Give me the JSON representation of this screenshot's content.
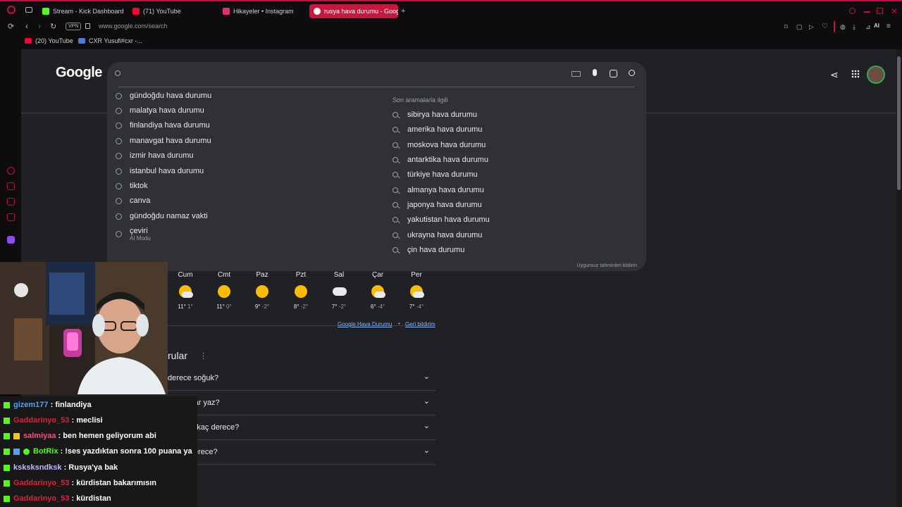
{
  "tabs": [
    {
      "label": "Stream - Kick Dashboard",
      "color": "#53fc18"
    },
    {
      "label": "(71) YouTube",
      "color": "#ff0033"
    },
    {
      "label": "Hikayeler • Instagram",
      "color": "#e1306c"
    },
    {
      "label": "rusya hava durumu - Goog",
      "color": "#ffffff",
      "active": true
    }
  ],
  "address": {
    "url": "www.google.com/search",
    "vpn": "VPN"
  },
  "bookmarks": [
    {
      "label": "(20) YouTube"
    },
    {
      "label": "CXR Yusufi#cxr -..."
    }
  ],
  "google": {
    "logo": "Google",
    "search_value": "",
    "related_header": "Son aramalarla ilgili",
    "recent": [
      {
        "label": "gündoğdu hava durumu"
      },
      {
        "label": "malatya hava durumu"
      },
      {
        "label": "finlandiya hava durumu"
      },
      {
        "label": "manavgat hava durumu"
      },
      {
        "label": "izmir hava durumu"
      },
      {
        "label": "istanbul hava durumu"
      },
      {
        "label": "tiktok"
      },
      {
        "label": "canva"
      },
      {
        "label": "gündoğdu namaz vakti"
      },
      {
        "label": "çeviri",
        "sub": "AI Modu"
      }
    ],
    "related": [
      "sibirya hava durumu",
      "amerika hava durumu",
      "moskova hava durumu",
      "antarktika hava durumu",
      "türkiye hava durumu",
      "almanya hava durumu",
      "japonya hava durumu",
      "yakutistan hava durumu",
      "ukrayna hava durumu",
      "çin hava durumu"
    ],
    "report": "Uygunsuz tahminleri bildirin"
  },
  "weather": {
    "days": [
      {
        "day": "Cum",
        "hi": "11°",
        "lo": "1°",
        "icon": "partly-cloudy"
      },
      {
        "day": "Cmt",
        "hi": "11°",
        "lo": "0°",
        "icon": "sunny"
      },
      {
        "day": "Paz",
        "hi": "9°",
        "lo": "-2°",
        "icon": "sunny"
      },
      {
        "day": "Pzt",
        "hi": "8°",
        "lo": "-2°",
        "icon": "sunny"
      },
      {
        "day": "Sal",
        "hi": "7°",
        "lo": "-2°",
        "icon": "cloudy"
      },
      {
        "day": "Çar",
        "hi": "6°",
        "lo": "-4°",
        "icon": "partly-cloudy"
      },
      {
        "day": "Per",
        "hi": "7°",
        "lo": "-4°",
        "icon": "partly-cloudy"
      }
    ],
    "source_link": "Google Hava Durumu",
    "feedback_link": "Geri bildirim"
  },
  "faq": {
    "title": "rular",
    "items": [
      "derece soğuk?",
      "Rusya'da hangi aylar yaz?",
      "Rusya'da en soğuk kaç derece?",
      "erece?"
    ]
  },
  "chat": [
    {
      "user": "gizem177",
      "msg": ": finlandiya",
      "cls": "u-blue"
    },
    {
      "user": "Gaddarinyo_53",
      "msg": ": meclisi",
      "cls": "u-red"
    },
    {
      "user": "salmiyaa",
      "msg": ": ben hemen geliyorum abi",
      "cls": "u-pink"
    },
    {
      "user": "BotRix",
      "msg": ": !ses yazdıktan sonra 100 puana ya",
      "cls": "u-green"
    },
    {
      "user": "ksksksndksk",
      "msg": ": Rusya'ya bak",
      "cls": "u-lav"
    },
    {
      "user": "Gaddarinyo_53",
      "msg": ": kürdistan bakarımısın",
      "cls": "u-red"
    },
    {
      "user": "Gaddarinyo_53",
      "msg": ": kürdistan",
      "cls": "u-red"
    }
  ]
}
